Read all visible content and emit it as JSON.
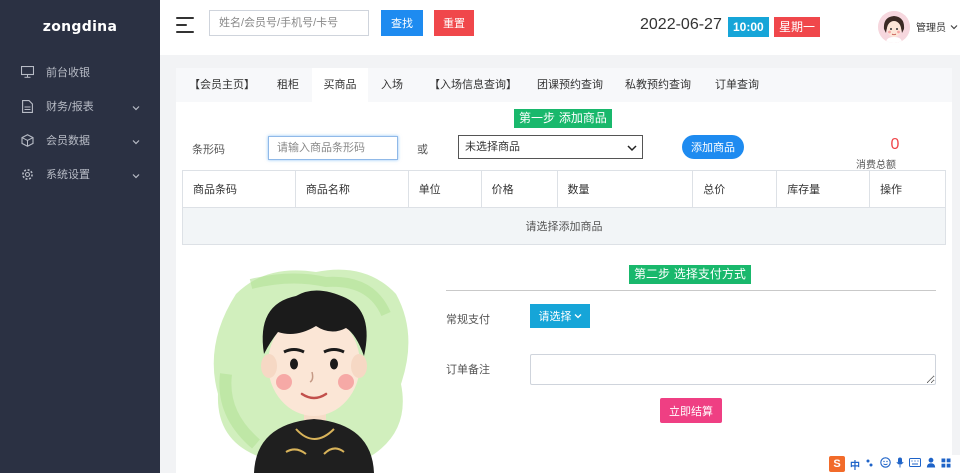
{
  "app": {
    "brand": "zongdina"
  },
  "sidebar": {
    "items": [
      {
        "label": "前台收银",
        "icon": "monitor-icon",
        "has_arrow": false
      },
      {
        "label": "财务/报表",
        "icon": "document-icon",
        "has_arrow": true
      },
      {
        "label": "会员数据",
        "icon": "cube-icon",
        "has_arrow": true
      },
      {
        "label": "系统设置",
        "icon": "gear-icon",
        "has_arrow": true
      }
    ]
  },
  "header": {
    "search_placeholder": "姓名/会员号/手机号/卡号",
    "search_label": "查找",
    "reset_label": "重置",
    "date": "2022-06-27",
    "time": "10:00",
    "weekday": "星期一",
    "user_name": "管理员"
  },
  "tabs": [
    {
      "label": "【会员主页】",
      "active": false
    },
    {
      "label": "租柜",
      "active": false
    },
    {
      "label": "买商品",
      "active": true
    },
    {
      "label": "入场",
      "active": false
    },
    {
      "label": "【入场信息查询】",
      "active": false
    },
    {
      "label": "团课预约查询",
      "active": false
    },
    {
      "label": "私教预约查询",
      "active": false
    },
    {
      "label": "订单查询",
      "active": false
    }
  ],
  "step1": {
    "title": "第一步 添加商品",
    "barcode_label": "条形码",
    "barcode_placeholder": "请输入商品条形码",
    "or_label": "或",
    "select_value": "未选择商品",
    "add_label": "添加商品",
    "total_value": "0",
    "total_label": "消费总额"
  },
  "table": {
    "columns": [
      "商品条码",
      "商品名称",
      "单位",
      "价格",
      "数量",
      "总价",
      "库存量",
      "操作"
    ],
    "empty_text": "请选择添加商品"
  },
  "step2": {
    "title": "第二步 选择支付方式",
    "payment_label": "常规支付",
    "payment_select": "请选择",
    "note_label": "订单备注",
    "note_value": "",
    "checkout_label": "立即结算"
  },
  "tray": {
    "ime_logo": "S",
    "ime_lang": "中",
    "icons": [
      "punctuation-icon",
      "emoji-icon",
      "microphone-icon",
      "keyboard-icon",
      "user-icon",
      "grid-icon"
    ]
  },
  "colors": {
    "sidebar_bg": "#2b3143",
    "primary": "#1e8bf0",
    "danger": "#f0474b",
    "success": "#19b86c",
    "info": "#16a5d8",
    "pink": "#ef3f83"
  }
}
